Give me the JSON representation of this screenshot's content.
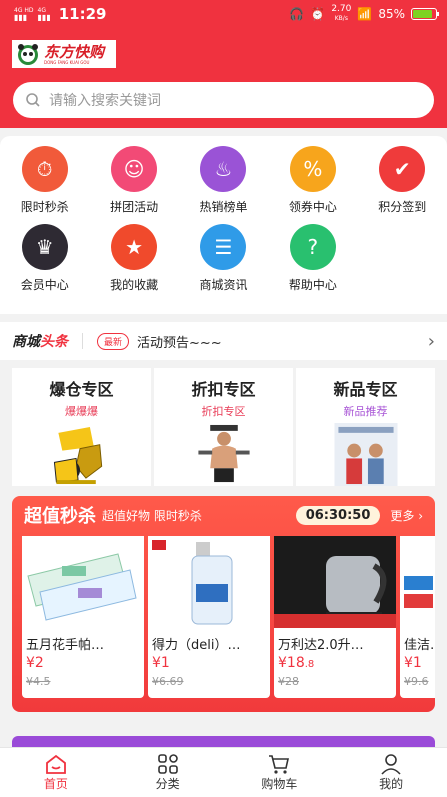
{
  "status": {
    "signal1": "4G HD",
    "signal2": "4G",
    "time": "11:29",
    "speed_value": "2.70",
    "speed_unit": "KB/s",
    "battery": "85%",
    "battery_level": 0.85
  },
  "logo": {
    "cn": "东方快购",
    "en": "DONG FANG KUAI GOU"
  },
  "search": {
    "placeholder": "请输入搜索关键词"
  },
  "menu": {
    "items": [
      {
        "label": "限时秒杀",
        "icon": "flash-sale-icon",
        "color": "#f15a3a"
      },
      {
        "label": "拼团活动",
        "icon": "group-buy-icon",
        "color": "#f24a76"
      },
      {
        "label": "热销榜单",
        "icon": "hot-list-icon",
        "color": "#9a53d6"
      },
      {
        "label": "领券中心",
        "icon": "coupon-icon",
        "color": "#f7a51c"
      },
      {
        "label": "积分签到",
        "icon": "points-checkin-icon",
        "color": "#ef3b3b"
      },
      {
        "label": "会员中心",
        "icon": "member-crown-icon",
        "color": "#2e2a33"
      },
      {
        "label": "我的收藏",
        "icon": "favorite-star-icon",
        "color": "#f04a2c"
      },
      {
        "label": "商城资讯",
        "icon": "news-icon",
        "color": "#2f9be8"
      },
      {
        "label": "帮助中心",
        "icon": "help-icon",
        "color": "#29c06f"
      }
    ]
  },
  "news": {
    "brand_a": "商城",
    "brand_b": "头条",
    "badge": "最新",
    "text": "活动预告~~~"
  },
  "zones": [
    {
      "title": "爆仓专区",
      "sub": "爆爆爆",
      "sub_color": "#e83a55"
    },
    {
      "title": "折扣专区",
      "sub": "折扣专区",
      "sub_color": "#e83a55"
    },
    {
      "title": "新品专区",
      "sub": "新品推荐",
      "sub_color": "#a855d6"
    }
  ],
  "flash": {
    "title": "超值秒杀",
    "sub": "超值好物 限时秒杀",
    "timer": "06:30:50",
    "more": "更多 ›",
    "products": [
      {
        "name": "五月花手帕…",
        "price": "¥2",
        "old": "¥4.5"
      },
      {
        "name": "得力（deli）…",
        "price": "¥1",
        "old": "¥6.69"
      },
      {
        "name": "万利达2.0升…",
        "price": "¥18",
        "price_dec": ".8",
        "old": "¥28"
      },
      {
        "name": "佳洁…",
        "price": "¥1",
        "old": "¥9.6"
      }
    ]
  },
  "tabs": [
    {
      "label": "首页",
      "icon": "home-icon"
    },
    {
      "label": "分类",
      "icon": "category-icon"
    },
    {
      "label": "购物车",
      "icon": "cart-icon"
    },
    {
      "label": "我的",
      "icon": "profile-icon"
    }
  ]
}
